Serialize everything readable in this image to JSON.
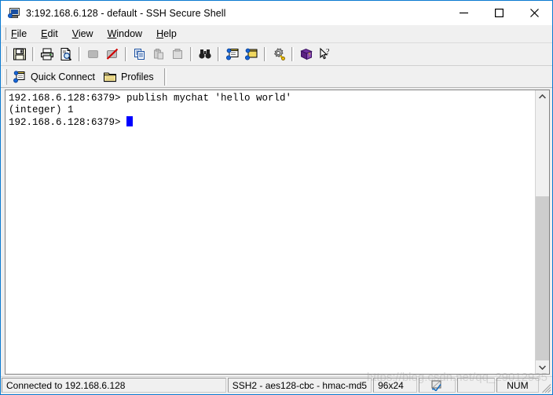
{
  "window": {
    "title": "3:192.168.6.128 - default - SSH Secure Shell",
    "icon": "ssh-terminal-icon",
    "controls": {
      "minimize": "Minimize",
      "maximize": "Maximize",
      "close": "Close"
    }
  },
  "menubar": {
    "items": [
      {
        "label": "File",
        "accel": "F"
      },
      {
        "label": "Edit",
        "accel": "E"
      },
      {
        "label": "View",
        "accel": "V"
      },
      {
        "label": "Window",
        "accel": "W"
      },
      {
        "label": "Help",
        "accel": "H"
      }
    ]
  },
  "toolbar": {
    "buttons": [
      {
        "name": "save-icon",
        "title": "Save"
      },
      {
        "name": "print-icon",
        "title": "Print"
      },
      {
        "name": "print-preview-icon",
        "title": "Print Preview"
      },
      {
        "name": "connect-icon",
        "title": "Connect"
      },
      {
        "name": "disconnect-icon",
        "title": "Disconnect"
      },
      {
        "name": "copy-icon",
        "title": "Copy"
      },
      {
        "name": "cut-icon",
        "title": "Cut"
      },
      {
        "name": "paste-icon",
        "title": "Paste"
      },
      {
        "name": "find-icon",
        "title": "Find"
      },
      {
        "name": "new-terminal-window-icon",
        "title": "New Terminal Window"
      },
      {
        "name": "new-file-transfer-window-icon",
        "title": "New File Transfer Window"
      },
      {
        "name": "settings-icon",
        "title": "Settings"
      },
      {
        "name": "help-book-icon",
        "title": "Help"
      },
      {
        "name": "context-help-icon",
        "title": "Context Help"
      }
    ]
  },
  "toolbar2": {
    "quick_connect": "Quick Connect",
    "profiles": "Profiles"
  },
  "terminal": {
    "lines": [
      "192.168.6.128:6379> publish mychat 'hello world'",
      "(integer) 1"
    ],
    "prompt": "192.168.6.128:6379> ",
    "cursor": "block",
    "cursor_color": "#0000ff",
    "background": "#ffffff",
    "foreground": "#000000"
  },
  "statusbar": {
    "connection": "Connected to 192.168.6.128",
    "cipher": "SSH2 - aes128-cbc - hmac-md5",
    "size": "96x24",
    "indicator_icon": "encryption-icon",
    "num_lock": "NUM",
    "watermark": "https://blog.csdn.net/qq_29012935"
  },
  "colors": {
    "title_accent": "#0a7ad0",
    "chrome": "#f0f0f0",
    "terminal_bg": "#ffffff",
    "cursor": "#0000ff"
  }
}
